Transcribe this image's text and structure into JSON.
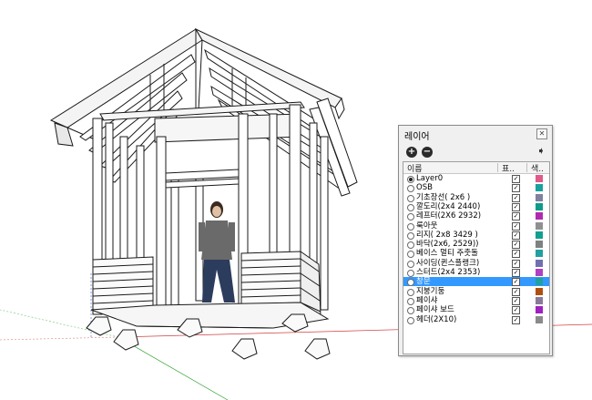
{
  "layers_panel": {
    "title": "레이어",
    "close_glyph": "✕",
    "add_glyph": "+",
    "remove_glyph": "−",
    "export_glyph": "➧",
    "col_name": "이름",
    "col_visible": "표..",
    "col_color": "색..",
    "layers": [
      {
        "name": "Layer0",
        "visible": true,
        "color": "#e05a8a",
        "active": true
      },
      {
        "name": "OSB",
        "visible": true,
        "color": "#1aa0a0"
      },
      {
        "name": "기초장선( 2x6 )",
        "visible": true,
        "color": "#8080a0"
      },
      {
        "name": "깔도리(2x4 2440)",
        "visible": true,
        "color": "#0f9a8a"
      },
      {
        "name": "레프터(2X6 2932)",
        "visible": true,
        "color": "#b02ab0"
      },
      {
        "name": "룩아웃",
        "visible": true,
        "color": "#909090"
      },
      {
        "name": "리지( 2x8 3429 )",
        "visible": true,
        "color": "#10a090"
      },
      {
        "name": "바닥(2x6, 2529))",
        "visible": true,
        "color": "#808080"
      },
      {
        "name": "베이스 멀티 주춧돌",
        "visible": true,
        "color": "#20a0a0"
      },
      {
        "name": "사이딩(퀸스플랭크)",
        "visible": true,
        "color": "#7070b0"
      },
      {
        "name": "스터드(2x4 2353)",
        "visible": true,
        "color": "#b040c0"
      },
      {
        "name": "창문",
        "visible": true,
        "color": "#20a0a0",
        "selected": true
      },
      {
        "name": "지붕기둥",
        "visible": true,
        "color": "#b05010"
      },
      {
        "name": "페이샤",
        "visible": true,
        "color": "#8a7a9a"
      },
      {
        "name": "페이샤 보드",
        "visible": true,
        "color": "#a020c0"
      },
      {
        "name": "헤더(2X10)",
        "visible": true,
        "color": "#8a8a8a"
      }
    ]
  }
}
